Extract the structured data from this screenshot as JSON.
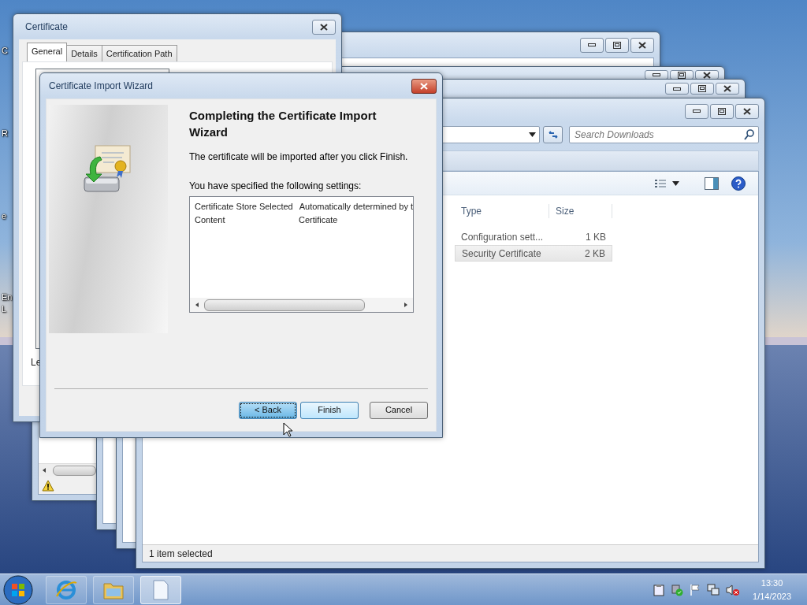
{
  "desktop": {
    "labels": [
      "C",
      "R",
      "e",
      "En",
      "L"
    ]
  },
  "certificate_window": {
    "title": "Certificate",
    "tabs": [
      {
        "label": "General",
        "selected": true
      },
      {
        "label": "Details",
        "selected": false
      },
      {
        "label": "Certification Path",
        "selected": false
      }
    ],
    "body_text": "Le"
  },
  "wizard": {
    "title": "Certificate Import Wizard",
    "heading": "Completing the Certificate Import Wizard",
    "intro": "The certificate will be imported after you click Finish.",
    "settings_label": "You have specified the following settings:",
    "settings": [
      {
        "name": "Certificate Store Selected",
        "value": "Automatically determined by t"
      },
      {
        "name": "Content",
        "value": "Certificate"
      }
    ],
    "buttons": [
      {
        "label": "< Back",
        "focused": true,
        "default": false
      },
      {
        "label": "Finish",
        "focused": false,
        "default": true
      },
      {
        "label": "Cancel",
        "focused": false,
        "default": false
      }
    ]
  },
  "explorer": {
    "search_placeholder": "Search Downloads",
    "columns": [
      "Type",
      "Size"
    ],
    "rows": [
      {
        "type": "Configuration sett...",
        "size": "1 KB",
        "selected": false
      },
      {
        "type": "Security Certificate",
        "size": "2 KB",
        "selected": true
      }
    ],
    "status": "1 item selected"
  },
  "taskbar": {
    "buttons": [
      {
        "kind": "browser",
        "active": false
      },
      {
        "kind": "folder",
        "active": false
      },
      {
        "kind": "document",
        "active": true
      }
    ],
    "time": "13:30",
    "date": "1/14/2023"
  }
}
